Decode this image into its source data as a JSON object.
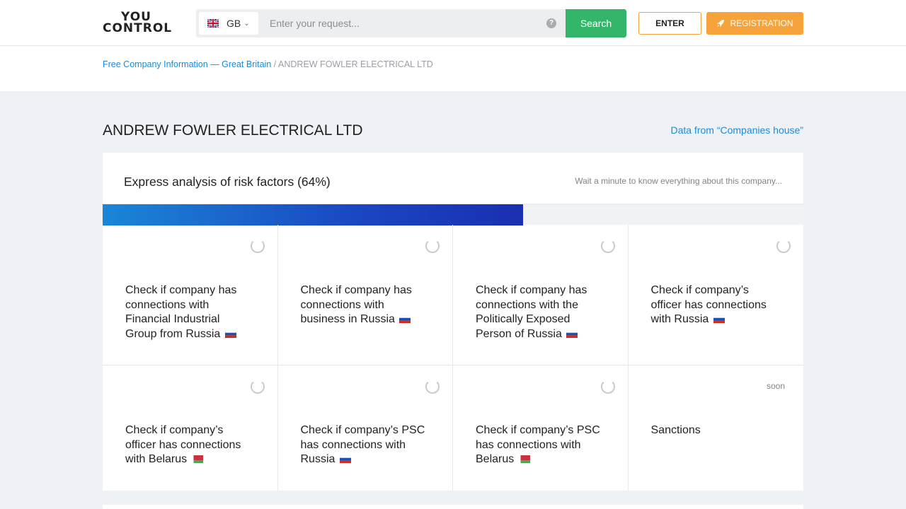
{
  "header": {
    "logo_line1": "YOU",
    "logo_line2": "CONTROL",
    "country_code": "GB",
    "search_placeholder": "Enter your request...",
    "help_glyph": "?",
    "search_label": "Search",
    "enter_label": "ENTER",
    "registration_label": "REGISTRATION"
  },
  "breadcrumb": {
    "link": "Free Company Information — Great Britain",
    "separator": " / ",
    "current": "ANDREW FOWLER ELECTRICAL LTD"
  },
  "company": {
    "title": "ANDREW FOWLER ELECTRICAL LTD",
    "data_source": "Data from “Companies house”"
  },
  "analysis": {
    "title": "Express analysis of risk factors (64%)",
    "hint": "Wait a minute to know everything about this company...",
    "progress_percent": 60
  },
  "checks": [
    {
      "text": "Check if company has connections with Financial Industrial Group from Russia",
      "flag": "ru",
      "status": "loading"
    },
    {
      "text": "Check if company has connections with business in Russia",
      "flag": "ru",
      "status": "loading"
    },
    {
      "text": "Check if company has connections with the Politically Exposed Person of Russia",
      "flag": "ru",
      "status": "loading"
    },
    {
      "text": "Check if company’s officer has connections with Russia",
      "flag": "ru",
      "status": "loading"
    },
    {
      "text": "Check if company’s officer has connections with Belarus",
      "flag": "by",
      "status": "loading"
    },
    {
      "text": "Check if company’s PSC has connections with Russia",
      "flag": "ru",
      "status": "loading"
    },
    {
      "text": "Check if company’s PSC has connections with Belarus",
      "flag": "by",
      "status": "loading"
    },
    {
      "text": "Sanctions",
      "flag": "",
      "status": "soon"
    }
  ],
  "colors": {
    "accent_blue": "#1e8bd6",
    "search_green": "#34b66a",
    "registration_orange": "#f5a33a"
  }
}
